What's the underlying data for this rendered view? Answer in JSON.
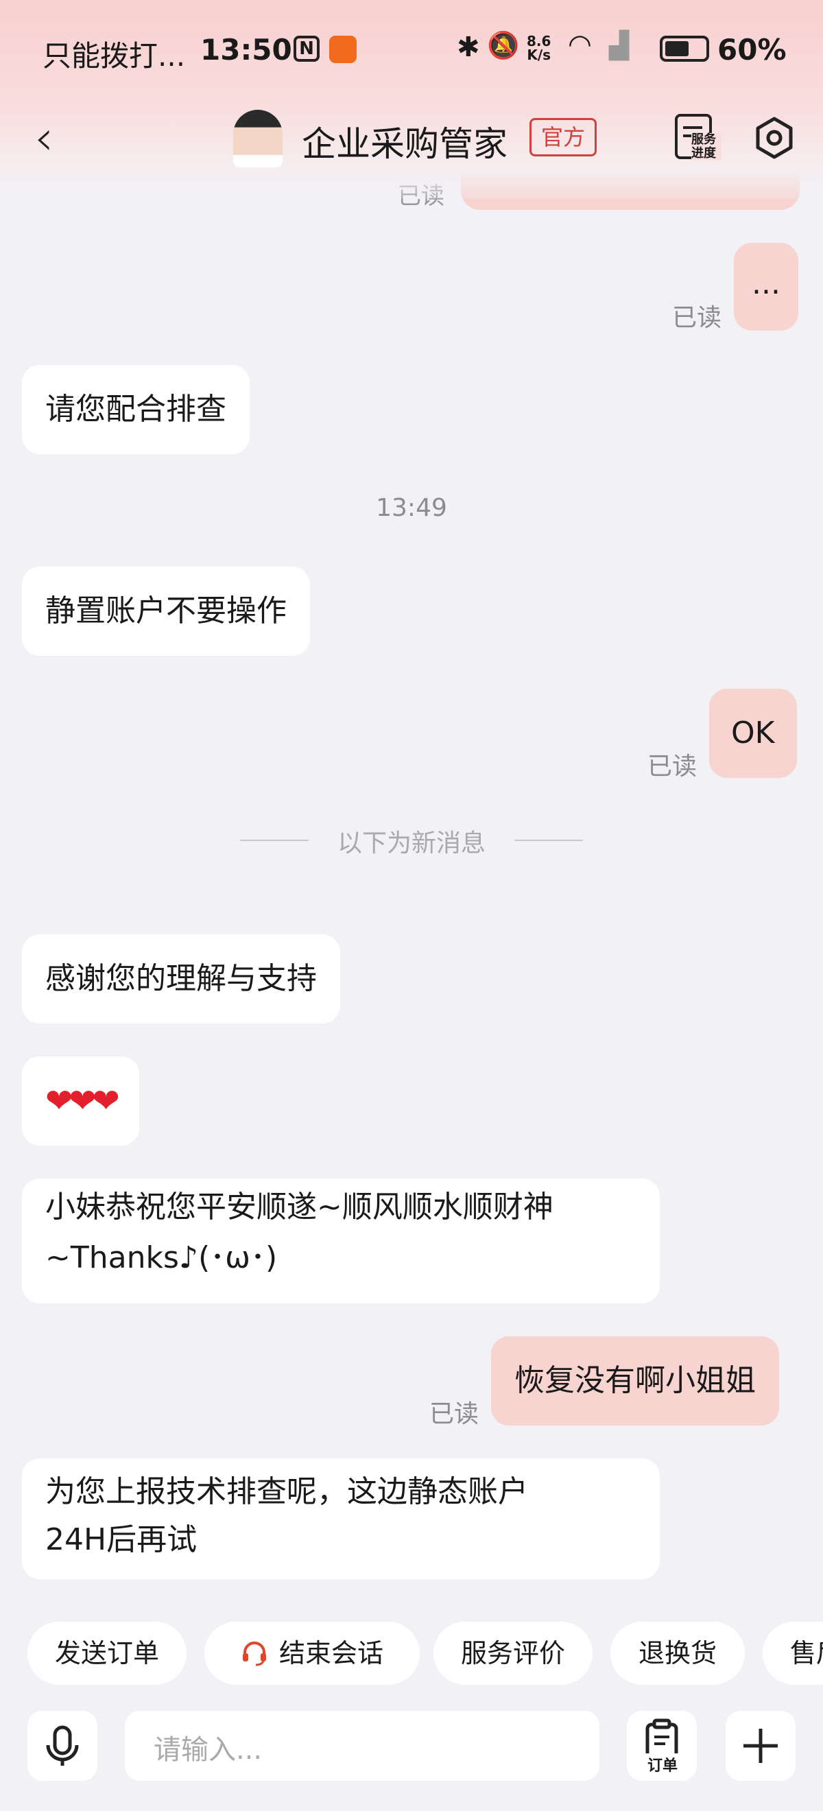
{
  "status_bar": {
    "carrier": "只能拨打...",
    "time": "13:50",
    "nfc": "N",
    "net_speed_top": "8.6",
    "net_speed_bottom": "K/s",
    "battery": "60%"
  },
  "header": {
    "title": "企业采购管家",
    "badge": "官方",
    "service_label": "服务进度"
  },
  "chat": {
    "top_read": "已读",
    "messages": [
      {
        "side": "out",
        "text": "...",
        "read": "已读"
      },
      {
        "side": "in",
        "text": "请您配合排查"
      },
      {
        "side": "time",
        "text": "13:49"
      },
      {
        "side": "in",
        "text": "静置账户不要操作"
      },
      {
        "side": "out",
        "text": "OK",
        "read": "已读"
      },
      {
        "side": "divider",
        "text": "以下为新消息"
      },
      {
        "side": "in",
        "text": "感谢您的理解与支持"
      },
      {
        "side": "in",
        "text": "❤❤❤"
      },
      {
        "side": "in",
        "text": "小妹恭祝您平安顺遂~顺风顺水顺财神~Thanks♪(･ω･)"
      },
      {
        "side": "out",
        "text": "恢复没有啊小姐姐",
        "read": "已读"
      },
      {
        "side": "in",
        "text": "为您上报技术排查呢，这边静态账户24H后再试"
      }
    ]
  },
  "quick_actions": [
    "发送订单",
    "结束会话",
    "服务评价",
    "退换货",
    "售后"
  ],
  "input": {
    "placeholder": "请输入...",
    "order_label": "订单"
  },
  "colors": {
    "accent": "#d0403c",
    "outgoing_bubble": "#f8d4d1",
    "incoming_bubble": "#ffffff",
    "background": "#f1f1f6"
  }
}
